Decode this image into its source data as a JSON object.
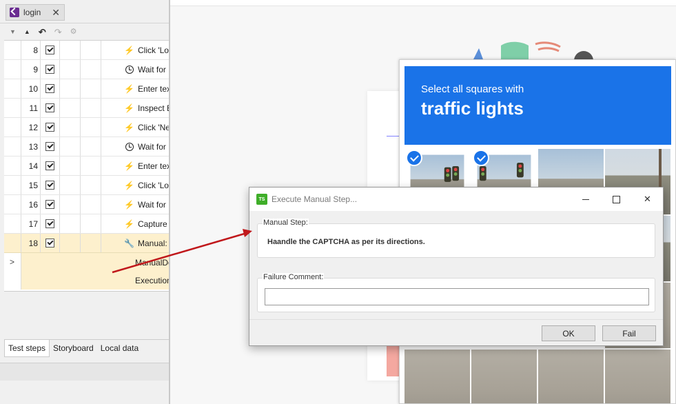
{
  "ide": {
    "tab_label": "login",
    "rows": [
      {
        "num": "8",
        "icon": "lightning-icon",
        "text": "Click 'Lo"
      },
      {
        "num": "9",
        "icon": "clock-icon",
        "text": "Wait for"
      },
      {
        "num": "10",
        "icon": "lightning-icon",
        "text": "Enter tex"
      },
      {
        "num": "11",
        "icon": "lightning-icon",
        "text": "Inspect E"
      },
      {
        "num": "12",
        "icon": "lightning-icon",
        "text": "Click 'Ne"
      },
      {
        "num": "13",
        "icon": "clock-icon",
        "text": "Wait for"
      },
      {
        "num": "14",
        "icon": "lightning-icon",
        "text": "Enter tex"
      },
      {
        "num": "15",
        "icon": "lightning-icon",
        "text": "Click 'Lo"
      },
      {
        "num": "16",
        "icon": "lightning-icon",
        "text": "Wait for"
      },
      {
        "num": "17",
        "icon": "lightning-icon",
        "text": "Capture"
      },
      {
        "num": "18",
        "icon": "wrench-icon",
        "text": "Manual:"
      }
    ],
    "detail": {
      "line1": "ManualDe",
      "line2": "Execution"
    },
    "bottom_tabs": [
      "Test steps",
      "Storyboard",
      "Local data"
    ]
  },
  "captcha": {
    "prompt_small": "Select all squares with",
    "prompt_big": "traffic lights",
    "accent": "#1a73e8"
  },
  "dialog": {
    "title": "Execute Manual Step...",
    "logo_text": "TS",
    "manual_label": "Manual Step:",
    "manual_text": "Haandle the CAPTCHA as per its directions.",
    "failure_label": "Failure Comment:",
    "failure_value": "",
    "ok_label": "OK",
    "fail_label": "Fail",
    "close_glyph": "✕"
  },
  "colors": {
    "selected_row": "#fdf0cd",
    "arrow": "#c0181b",
    "testsuite_green": "#3fae29"
  }
}
